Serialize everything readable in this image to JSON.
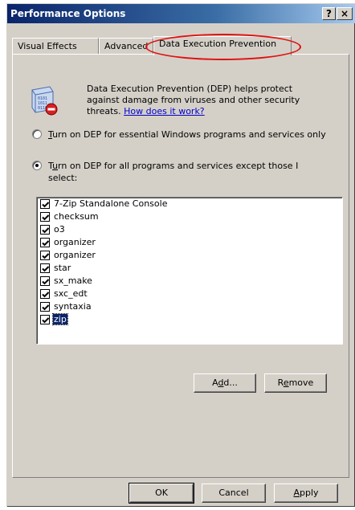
{
  "window": {
    "title": "Performance Options",
    "help_glyph": "?",
    "close_glyph": "×"
  },
  "tabs": [
    {
      "label": "Visual Effects"
    },
    {
      "label": "Advanced"
    },
    {
      "label": "Data Execution Prevention",
      "active": true
    }
  ],
  "info": {
    "text": "Data Execution Prevention (DEP) helps protect against damage from viruses and other security threats.",
    "link": "How does it work?",
    "icon": "dep-shield-icon"
  },
  "options": {
    "essential": {
      "label_prefix": "",
      "accel": "T",
      "label_rest": "urn on DEP for essential Windows programs and services only",
      "checked": false
    },
    "all": {
      "label_prefix": "T",
      "accel": "u",
      "label_rest": "rn on DEP for all programs and services except those I select:",
      "checked": true
    }
  },
  "programs": [
    {
      "name": "7-Zip Standalone Console",
      "checked": true
    },
    {
      "name": "checksum",
      "checked": true
    },
    {
      "name": "o3",
      "checked": true
    },
    {
      "name": "organizer",
      "checked": true
    },
    {
      "name": "organizer",
      "checked": true
    },
    {
      "name": "star",
      "checked": true
    },
    {
      "name": "sx_make",
      "checked": true
    },
    {
      "name": "sxc_edt",
      "checked": true
    },
    {
      "name": "syntaxia",
      "checked": true
    },
    {
      "name": "zip",
      "checked": true,
      "selected": true
    }
  ],
  "buttons": {
    "add_pre": "A",
    "add_accel": "d",
    "add_post": "d...",
    "remove_pre": "R",
    "remove_accel": "e",
    "remove_post": "move",
    "ok": "OK",
    "cancel": "Cancel",
    "apply_accel": "A",
    "apply_post": "pply"
  },
  "colors": {
    "dialog_bg": "#d4d0c8",
    "title_gradient_start": "#0a246a",
    "selection": "#0a246a",
    "annotation_circle": "#e01010"
  }
}
